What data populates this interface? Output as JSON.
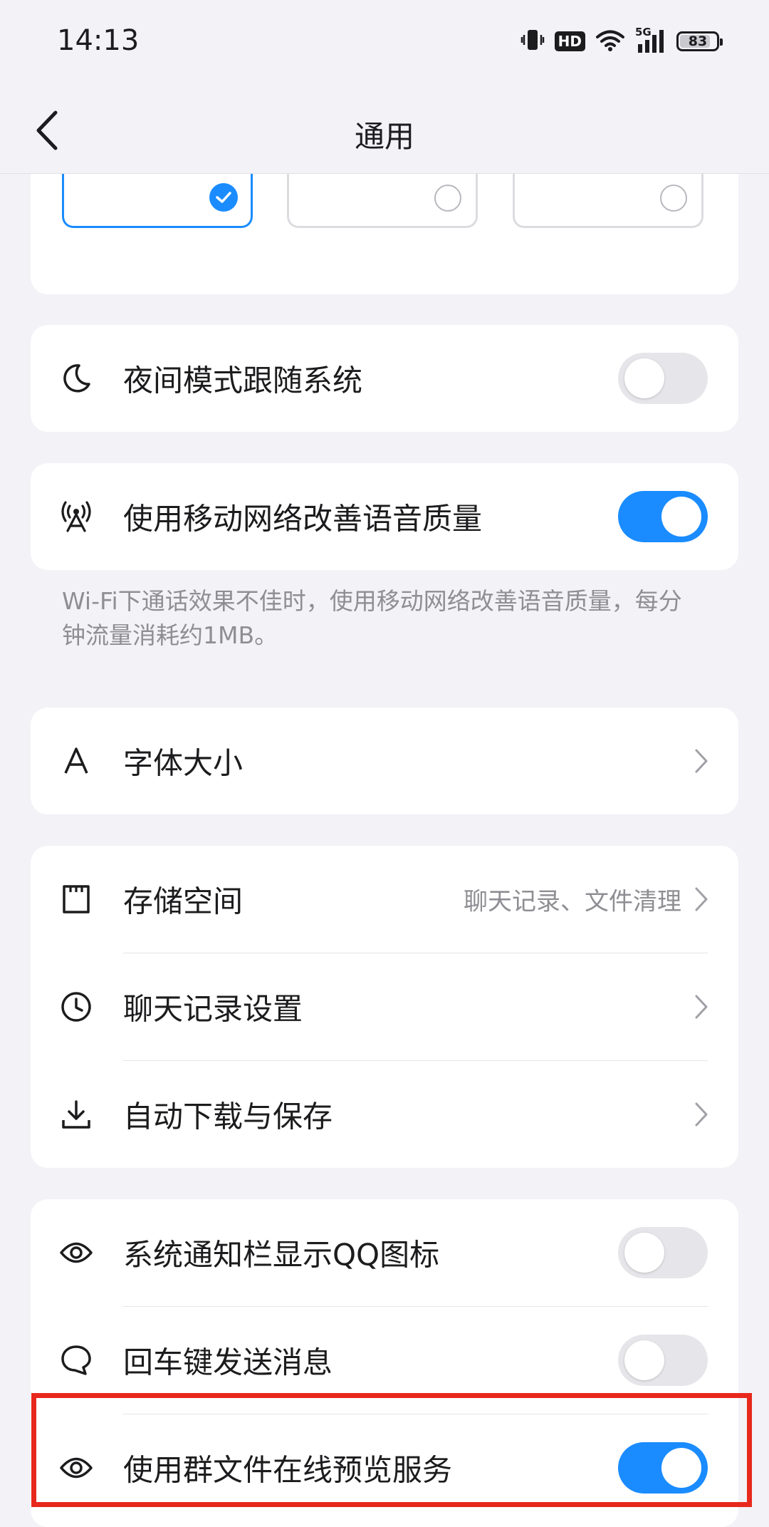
{
  "status_bar": {
    "time": "14:13",
    "hd": "HD",
    "network": "5G",
    "battery": "83"
  },
  "header": {
    "title": "通用"
  },
  "theme_selector": {
    "options": [
      {
        "selected": true
      },
      {
        "selected": false
      },
      {
        "selected": false
      }
    ]
  },
  "night_mode": {
    "label": "夜间模式跟随系统",
    "enabled": false
  },
  "mobile_voice": {
    "label": "使用移动网络改善语音质量",
    "enabled": true,
    "note": "Wi-Fi下通话效果不佳时，使用移动网络改善语音质量，每分钟流量消耗约1MB。"
  },
  "font_size": {
    "label": "字体大小"
  },
  "storage_group": {
    "storage": {
      "label": "存储空间",
      "subtitle": "聊天记录、文件清理"
    },
    "chat_history": {
      "label": "聊天记录设置"
    },
    "auto_download": {
      "label": "自动下载与保存"
    }
  },
  "toggles_group": {
    "notification_icon": {
      "label": "系统通知栏显示QQ图标",
      "enabled": false
    },
    "enter_send": {
      "label": "回车键发送消息",
      "enabled": false
    },
    "group_file_preview": {
      "label": "使用群文件在线预览服务",
      "enabled": true
    }
  },
  "colors": {
    "accent": "#1a8cff",
    "highlight": "#e8281c",
    "background": "#f2f2f7"
  }
}
